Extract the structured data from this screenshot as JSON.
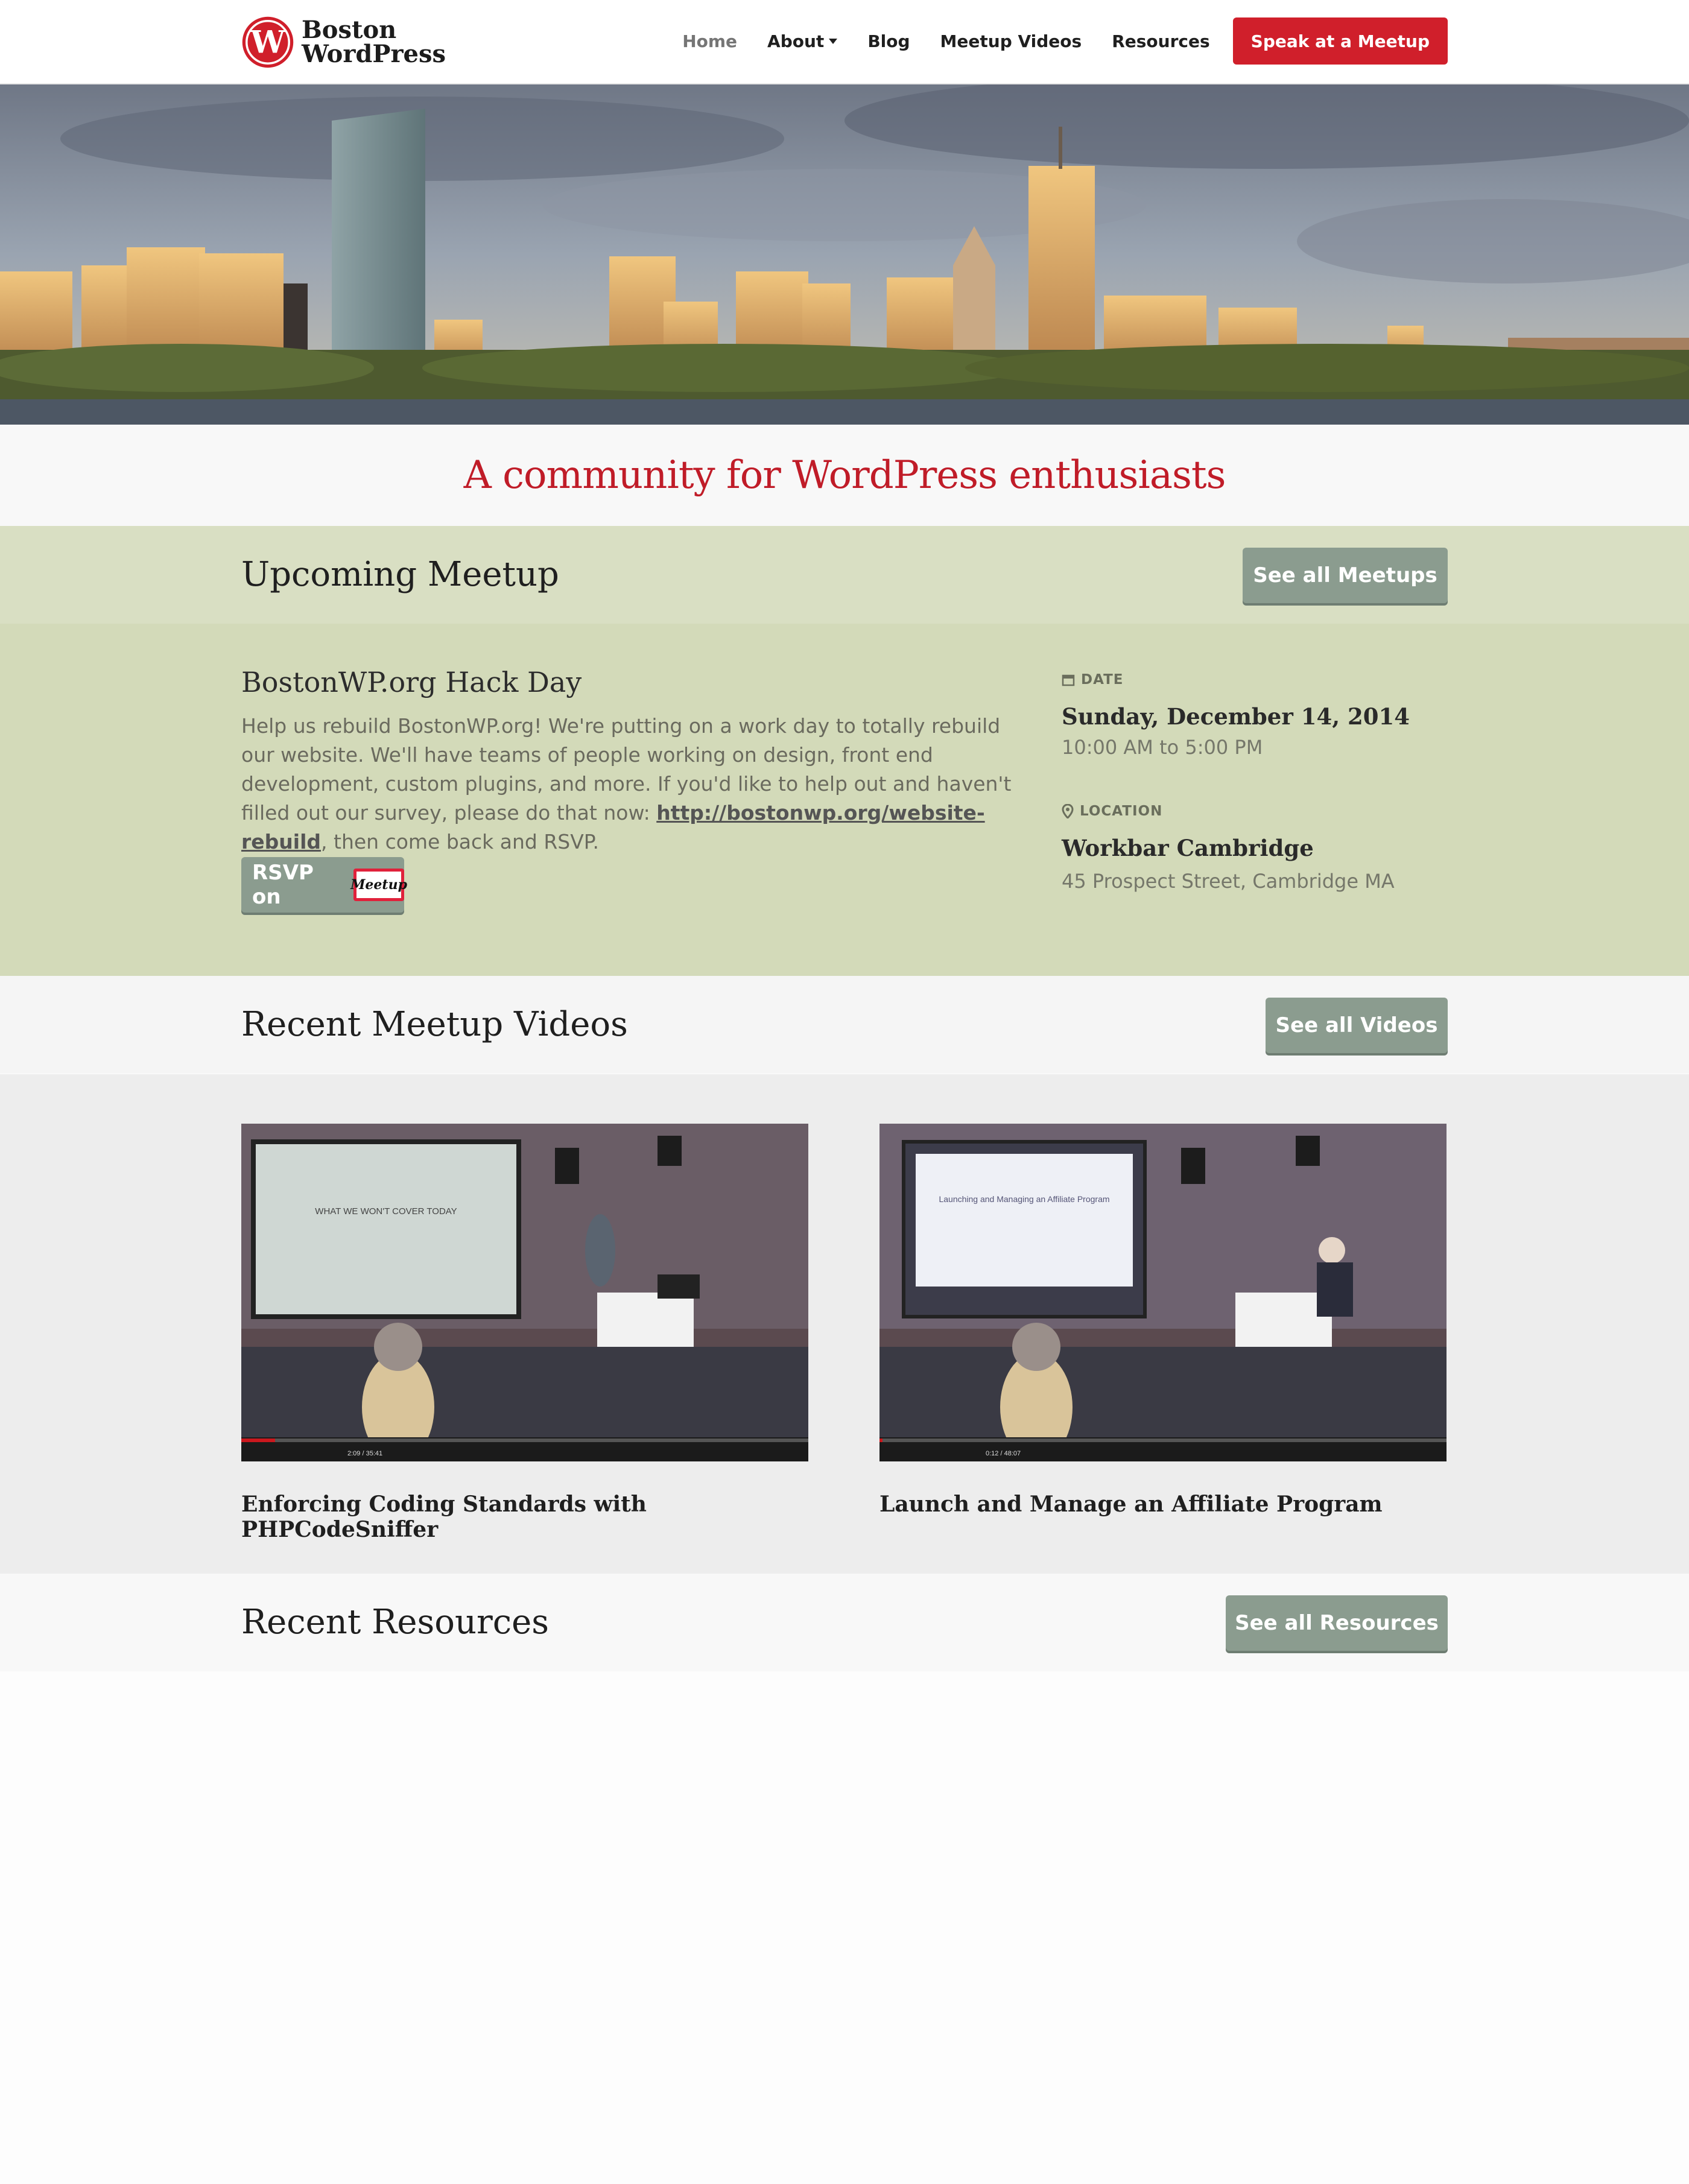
{
  "header": {
    "logo_line1": "Boston",
    "logo_line2": "WordPress",
    "nav": [
      {
        "label": "Home",
        "active": true
      },
      {
        "label": "About",
        "dropdown": true
      },
      {
        "label": "Blog"
      },
      {
        "label": "Meetup Videos"
      },
      {
        "label": "Resources"
      }
    ],
    "cta_label": "Speak at a Meetup"
  },
  "tagline": "A community for WordPress enthusiasts",
  "upcoming": {
    "heading": "Upcoming Meetup",
    "see_all_label": "See all Meetups",
    "event_title": "BostonWP.org Hack Day",
    "description_part1": "Help us rebuild BostonWP.org! We're putting on a work day to totally rebuild our website. We'll have teams of people working on design, front end development, custom plugins, and more. If you'd like to help out and haven't filled out our survey, please do that now: ",
    "description_link": "http://bostonwp.org/website-rebuild",
    "description_part2": ", then come back and RSVP.",
    "rsvp_label": "RSVP on",
    "rsvp_logo": "Meetup",
    "date_label": "DATE",
    "date": "Sunday, December 14, 2014",
    "time": "10:00 AM to 5:00 PM",
    "location_label": "LOCATION",
    "venue": "Workbar Cambridge",
    "address": "45 Prospect Street, Cambridge MA"
  },
  "videos": {
    "heading": "Recent Meetup Videos",
    "see_all_label": "See all Videos",
    "items": [
      {
        "title": "Enforcing Coding Standards with PHPCodeSniffer",
        "slide_title": "WHAT WE WON'T COVER TODAY",
        "time": "2:09 / 35:41",
        "progress": 0.06
      },
      {
        "title": "Launch and Manage an Affiliate Program",
        "slide_title": "Launching and Managing an Affiliate Program",
        "time": "0:12 / 48:07",
        "progress": 0.005
      }
    ]
  },
  "resources": {
    "heading": "Recent Resources",
    "see_all_label": "See all Resources"
  },
  "colors": {
    "brand_red": "#d01f2b",
    "button_grey": "#8b9c8f",
    "meetup_band_head": "#d9dfc3",
    "meetup_band_body": "#d3dab9"
  }
}
